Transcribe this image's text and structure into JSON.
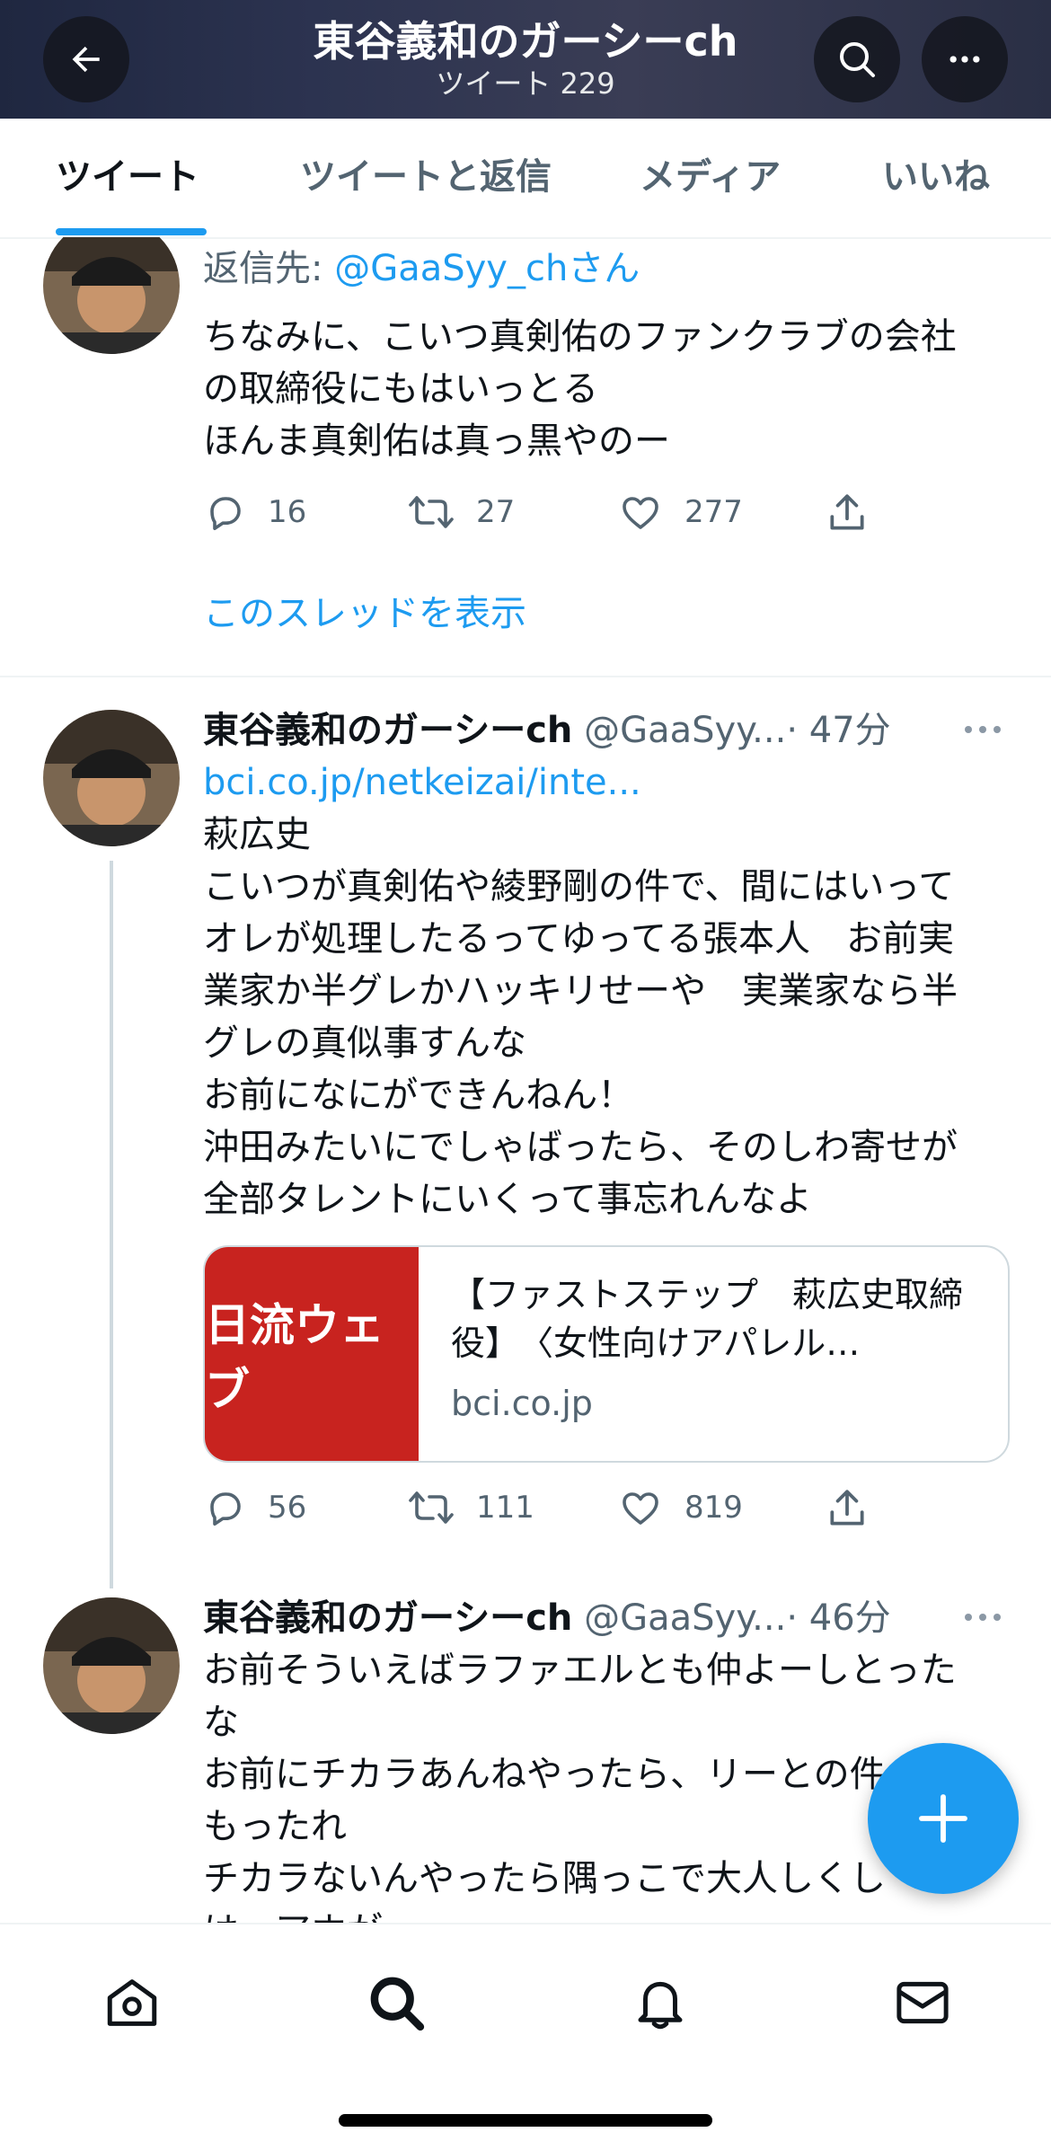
{
  "header": {
    "title": "東谷義和のガーシーch",
    "subtitle": "ツイート 229"
  },
  "tabs": [
    {
      "label": "ツイート",
      "active": true
    },
    {
      "label": "ツイートと返信",
      "active": false
    },
    {
      "label": "メディア",
      "active": false
    },
    {
      "label": "いいね",
      "active": false
    }
  ],
  "tweets": [
    {
      "reply_prefix": "返信先: ",
      "reply_handle": "@GaaSyy_ch",
      "reply_suffix": "さん",
      "text": "ちなみに、こいつ真剣佑のファンクラブの会社\nの取締役にもはいっとる\nほんま真剣佑は真っ黒やのー",
      "replies": "16",
      "retweets": "27",
      "likes": "277",
      "show_thread": "このスレッドを表示"
    },
    {
      "name": "東谷義和のガーシーch",
      "handle": "@GaaSyy...",
      "time": "· 47分",
      "link": "bci.co.jp/netkeizai/inte...",
      "text": "萩広史\nこいつが真剣佑や綾野剛の件で、間にはいって\nオレが処理したるってゆってる張本人　お前実\n業家か半グレかハッキリせーや　実業家なら半\nグレの真似事すんな\nお前になにができんねん！\n沖田みたいにでしゃばったら、そのしわ寄せが\n全部タレントにいくって事忘れんなよ",
      "card": {
        "image_text": "日流ウェブ",
        "title": "【ファストステップ　萩広史取締役】　〈女性向けアパレル…",
        "domain": "bci.co.jp"
      },
      "replies": "56",
      "retweets": "111",
      "likes": "819"
    },
    {
      "name": "東谷義和のガーシーch",
      "handle": "@GaaSyy...",
      "time": "· 46分",
      "text": "お前そういえばラファエルとも仲よーしとった\nな\nお前にチカラあんねやったら、リーとの件\nもったれ\nチカラないんやったら隅っこで大人しくし\nは　アホが"
    }
  ],
  "colors": {
    "accent": "#1d9bf0",
    "text": "#0f1419",
    "secondary": "#536471"
  },
  "icons": {
    "back": "arrow-left-icon",
    "search": "search-icon",
    "more": "more-icon",
    "home": "home-icon",
    "explore": "search-icon",
    "notifications": "bell-icon",
    "messages": "mail-icon",
    "compose": "plus-icon"
  }
}
